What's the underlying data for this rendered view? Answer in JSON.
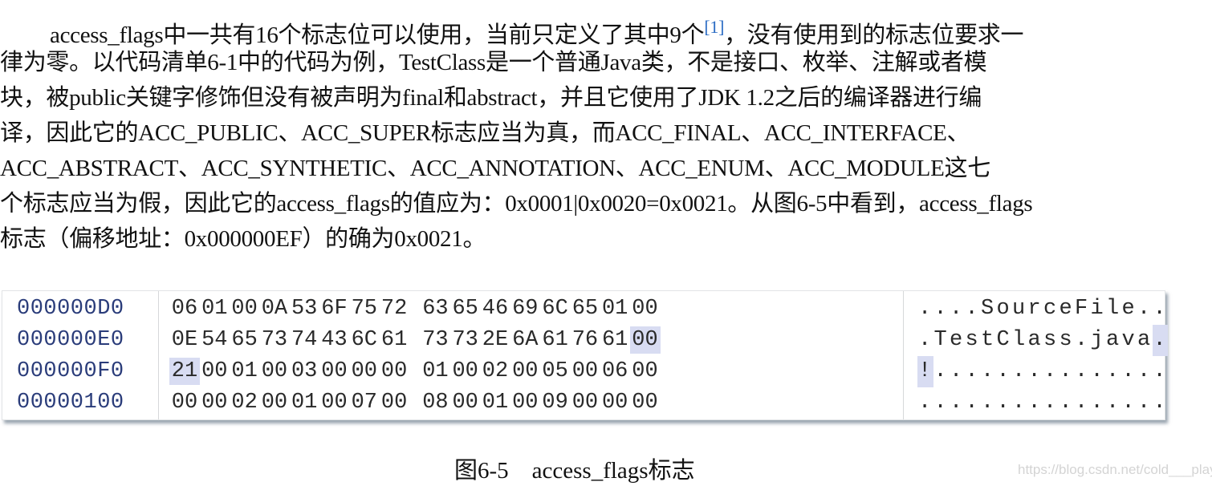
{
  "paragraph": {
    "lines": [
      "access_flags中一共有16个标志位可以使用，当前只定义了其中9个",
      "律为零。以代码清单6-1中的代码为例，TestClass是一个普通Java类，不是接口、枚举、注解或者模",
      "块，被public关键字修饰但没有被声明为final和abstract，并且它使用了JDK 1.2之后的编译器进行编",
      "译，因此它的ACC_PUBLIC、ACC_SUPER标志应当为真，而ACC_FINAL、ACC_INTERFACE、",
      "ACC_ABSTRACT、ACC_SYNTHETIC、ACC_ANNOTATION、ACC_ENUM、ACC_MODULE这七",
      "个标志应当为假，因此它的access_flags的值应为：0x0001|0x0020=0x0021。从图6-5中看到，access_flags",
      "标志（偏移地址：0x000000EF）的确为0x0021。"
    ],
    "footnote_ref": "[1]",
    "line1_tail": "，没有使用到的标志位要求一"
  },
  "hexdump": {
    "highlight_color": "#d8dcf2",
    "rows": [
      {
        "address": "000000D0",
        "bytes": [
          "06",
          "01",
          "00",
          "0A",
          "53",
          "6F",
          "75",
          "72",
          "63",
          "65",
          "46",
          "69",
          "6C",
          "65",
          "01",
          "00"
        ],
        "ascii": "....SourceFile..",
        "highlight_bytes": [],
        "highlight_chars": []
      },
      {
        "address": "000000E0",
        "bytes": [
          "0E",
          "54",
          "65",
          "73",
          "74",
          "43",
          "6C",
          "61",
          "73",
          "73",
          "2E",
          "6A",
          "61",
          "76",
          "61",
          "00"
        ],
        "ascii": ".TestClass.java.",
        "highlight_bytes": [
          15
        ],
        "highlight_chars": [
          15
        ]
      },
      {
        "address": "000000F0",
        "bytes": [
          "21",
          "00",
          "01",
          "00",
          "03",
          "00",
          "00",
          "00",
          "01",
          "00",
          "02",
          "00",
          "05",
          "00",
          "06",
          "00"
        ],
        "ascii": "!...............",
        "highlight_bytes": [
          0
        ],
        "highlight_chars": [
          0
        ]
      },
      {
        "address": "00000100",
        "bytes": [
          "00",
          "00",
          "02",
          "00",
          "01",
          "00",
          "07",
          "00",
          "08",
          "00",
          "01",
          "00",
          "09",
          "00",
          "00",
          "00"
        ],
        "ascii": "................",
        "highlight_bytes": [],
        "highlight_chars": []
      }
    ]
  },
  "caption": "图6-5    access_flags标志",
  "watermark": "https://blog.csdn.net/cold___play"
}
